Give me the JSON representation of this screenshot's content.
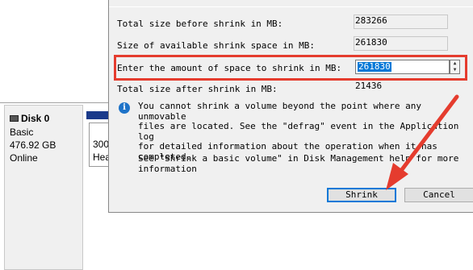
{
  "background": {
    "disk": {
      "title": "Disk 0",
      "type": "Basic",
      "size": "476.92 GB",
      "status": "Online"
    },
    "volume": {
      "line1": "300",
      "line2": "Hea"
    }
  },
  "dialog": {
    "rows": [
      {
        "label": "Total size before shrink in MB:",
        "value": "283266"
      },
      {
        "label": "Size of available shrink space in MB:",
        "value": "261830"
      },
      {
        "label": "Enter the amount of space to shrink in MB:",
        "value": "261830"
      },
      {
        "label": "Total size after shrink in MB:",
        "value": "21436"
      }
    ],
    "info_text": "You cannot shrink a volume beyond the point where any unmovable\nfiles are located. See the \"defrag\" event in the Application log\nfor detailed information about the operation when it has completed.",
    "help_text": "See \"Shrink a basic volume\" in Disk Management help for more\ninformation",
    "buttons": {
      "shrink": "Shrink",
      "cancel": "Cancel"
    }
  },
  "colors": {
    "highlight": "#e53c2e",
    "accent": "#0078d7"
  },
  "icons": {
    "info": "info-icon",
    "disk": "disk-icon",
    "spin_up": "spin-up-icon",
    "spin_down": "spin-down-icon"
  }
}
